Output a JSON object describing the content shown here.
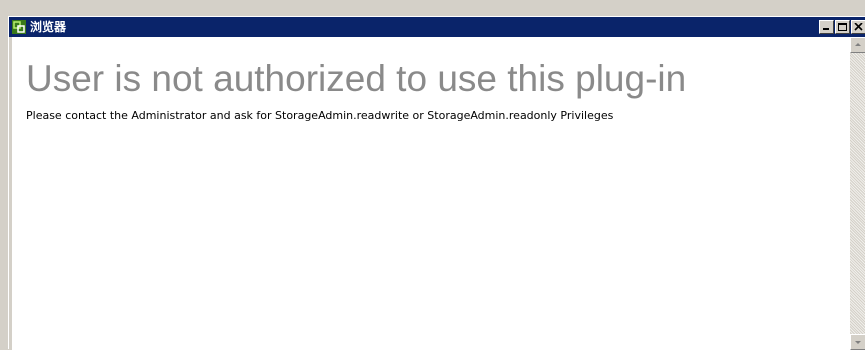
{
  "window": {
    "title": "浏览器",
    "title_bar_color": "#0a246a",
    "icons": {
      "app": "vsphere-plugin-icon",
      "minimize": "minimize-icon",
      "maximize": "maximize-icon",
      "close": "close-icon"
    }
  },
  "content": {
    "heading": "User is not authorized to use this plug-in",
    "message": "Please contact the Administrator and ask for StorageAdmin.readwrite or StorageAdmin.readonly Privileges",
    "heading_color": "#8a8a8a"
  },
  "scrollbar": {
    "up_icon": "scroll-up-arrow-icon",
    "down_icon": "scroll-down-arrow-icon"
  }
}
